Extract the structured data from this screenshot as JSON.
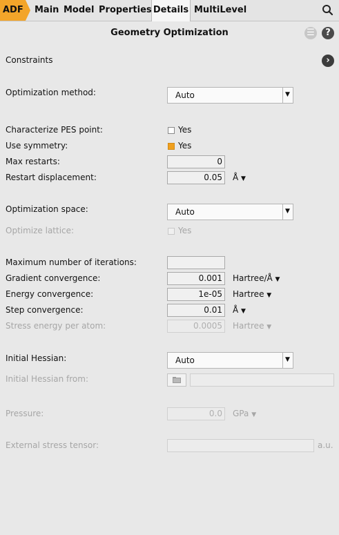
{
  "tabs": {
    "adf": "ADF",
    "main": "Main",
    "model": "Model",
    "properties": "Properties",
    "details": "Details",
    "multilevel": "MultiLevel"
  },
  "panel": {
    "title": "Geometry Optimization",
    "menu_glyph": "☰",
    "help_glyph": "?",
    "next_glyph": "›"
  },
  "constraints": {
    "label": "Constraints"
  },
  "opt_method": {
    "label": "Optimization method:",
    "value": "Auto"
  },
  "pes": {
    "label": "Characterize PES point:",
    "checkbox": "Yes",
    "checked": false
  },
  "symmetry": {
    "label": "Use symmetry:",
    "checkbox": "Yes",
    "checked": true
  },
  "max_restarts": {
    "label": "Max restarts:",
    "value": "0"
  },
  "restart_disp": {
    "label": "Restart displacement:",
    "value": "0.05",
    "unit": "Å"
  },
  "opt_space": {
    "label": "Optimization space:",
    "value": "Auto"
  },
  "opt_lattice": {
    "label": "Optimize lattice:",
    "checkbox": "Yes"
  },
  "max_iter": {
    "label": "Maximum number of iterations:",
    "value": ""
  },
  "grad_conv": {
    "label": "Gradient convergence:",
    "value": "0.001",
    "unit": "Hartree/Å"
  },
  "energy_conv": {
    "label": "Energy convergence:",
    "value": "1e-05",
    "unit": "Hartree"
  },
  "step_conv": {
    "label": "Step convergence:",
    "value": "0.01",
    "unit": "Å"
  },
  "stress_energy": {
    "label": "Stress energy per atom:",
    "value": "0.0005",
    "unit": "Hartree"
  },
  "init_hessian": {
    "label": "Initial Hessian:",
    "value": "Auto"
  },
  "init_hessian_from": {
    "label": "Initial Hessian from:"
  },
  "pressure": {
    "label": "Pressure:",
    "value": "0.0",
    "unit": "GPa"
  },
  "stress_tensor": {
    "label": "External stress tensor:",
    "unit": "a.u."
  },
  "colors": {
    "accent": "#f3a52a",
    "disabled_text": "#a6a6a6",
    "background": "#e8e8e8"
  },
  "icons": [
    "search-icon",
    "menu-icon",
    "help-icon",
    "chevron-right-icon",
    "chevron-down-icon",
    "folder-icon"
  ]
}
